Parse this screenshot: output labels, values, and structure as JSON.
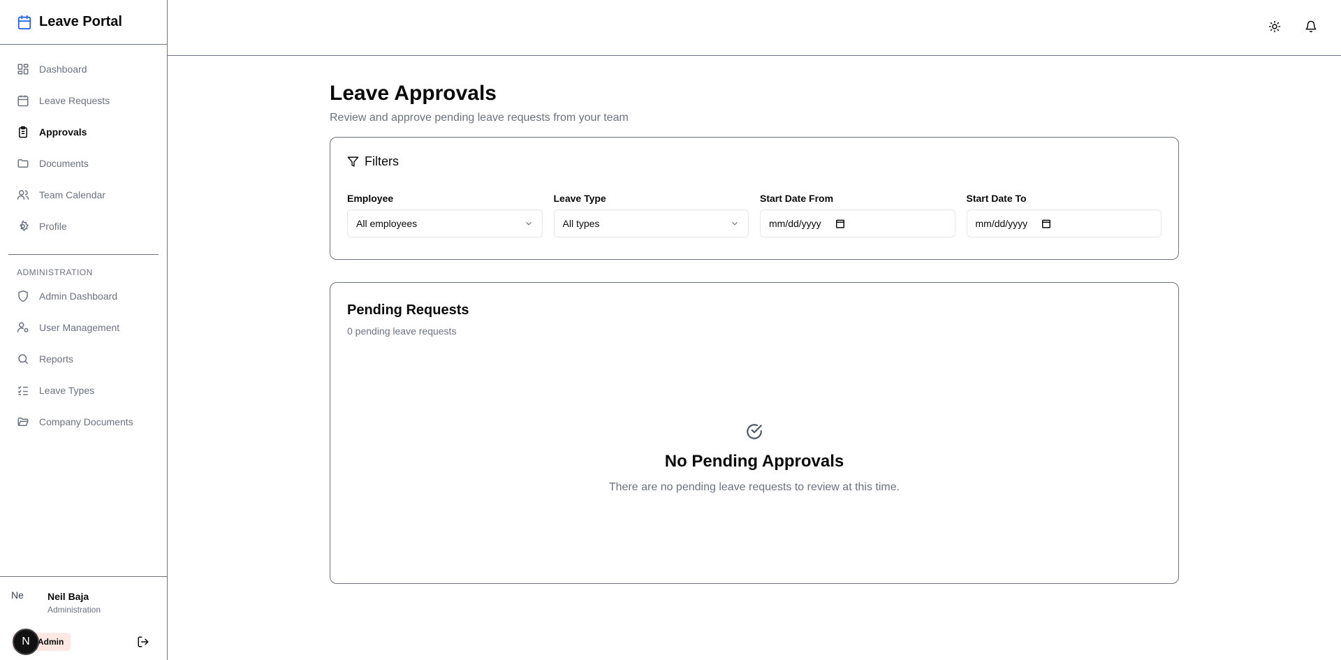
{
  "app": {
    "title": "Leave Portal"
  },
  "sidebar": {
    "items": [
      {
        "label": "Dashboard",
        "icon": "dashboard-icon"
      },
      {
        "label": "Leave Requests",
        "icon": "calendar-icon"
      },
      {
        "label": "Approvals",
        "icon": "clipboard-check-icon",
        "active": true
      },
      {
        "label": "Documents",
        "icon": "folder-icon"
      },
      {
        "label": "Team Calendar",
        "icon": "users-icon"
      },
      {
        "label": "Profile",
        "icon": "gear-icon"
      }
    ],
    "admin_section_label": "ADMINISTRATION",
    "admin_items": [
      {
        "label": "Admin Dashboard",
        "icon": "shield-icon"
      },
      {
        "label": "User Management",
        "icon": "user-cog-icon"
      },
      {
        "label": "Reports",
        "icon": "search-icon"
      },
      {
        "label": "Leave Types",
        "icon": "list-checks-icon"
      },
      {
        "label": "Company Documents",
        "icon": "folder-open-icon"
      }
    ]
  },
  "user": {
    "avatar_alt": "Ne",
    "name": "Neil Baja",
    "department": "Administration",
    "role_badge": "Admin",
    "avatar_letter": "N"
  },
  "page": {
    "title": "Leave Approvals",
    "subtitle": "Review and approve pending leave requests from your team"
  },
  "filters": {
    "heading": "Filters",
    "employee": {
      "label": "Employee",
      "value": "All employees"
    },
    "leave_type": {
      "label": "Leave Type",
      "value": "All types"
    },
    "start_from": {
      "label": "Start Date From",
      "placeholder": "mm/dd/yyyy"
    },
    "start_to": {
      "label": "Start Date To",
      "placeholder": "mm/dd/yyyy"
    }
  },
  "pending": {
    "title": "Pending Requests",
    "count_text": "0 pending leave requests",
    "empty_title": "No Pending Approvals",
    "empty_text": "There are no pending leave requests to review at this time."
  },
  "colors": {
    "brand": "#2563eb",
    "border": "#6b7280",
    "muted": "#6b7280",
    "badge_bg": "#fde8e4"
  }
}
